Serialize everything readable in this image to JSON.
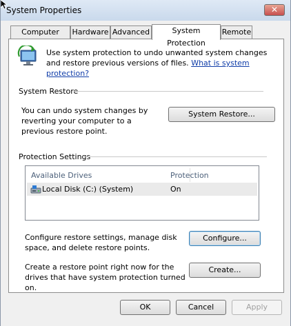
{
  "window": {
    "title": "System Properties",
    "close_symbol": "✕"
  },
  "tabs": [
    {
      "label": "Computer Name"
    },
    {
      "label": "Hardware"
    },
    {
      "label": "Advanced"
    },
    {
      "label": "System Protection",
      "active": true
    },
    {
      "label": "Remote"
    }
  ],
  "intro": {
    "text": "Use system protection to undo unwanted system changes and restore previous versions of files.",
    "link": "What is system protection?"
  },
  "system_restore": {
    "heading": "System Restore",
    "description": "You can undo system changes by reverting your computer to a previous restore point.",
    "button": "System Restore..."
  },
  "protection_settings": {
    "heading": "Protection Settings",
    "columns": [
      "Available Drives",
      "Protection"
    ],
    "rows": [
      {
        "drive": "Local Disk (C:) (System)",
        "protection": "On"
      }
    ],
    "configure_text": "Configure restore settings, manage disk space, and delete restore points.",
    "configure_button": "Configure...",
    "create_text": "Create a restore point right now for the drives that have system protection turned on.",
    "create_button": "Create..."
  },
  "footer": {
    "ok": "OK",
    "cancel": "Cancel",
    "apply": "Apply"
  },
  "colors": {
    "link": "#0f3ca8",
    "close_button": "#c75050",
    "title_bar": "#c9d9ec"
  }
}
